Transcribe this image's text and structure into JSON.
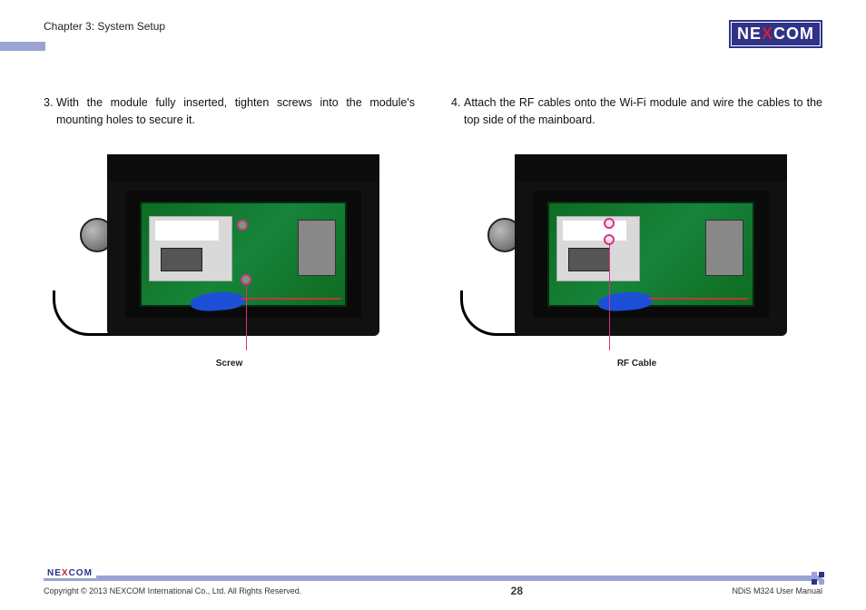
{
  "header": {
    "chapter": "Chapter 3: System Setup",
    "logo_pre": "NE",
    "logo_x": "X",
    "logo_post": "COM"
  },
  "steps": {
    "s3": {
      "num": "3.",
      "text": "With the module fully inserted, tighten screws into the module's mounting holes to secure it."
    },
    "s4": {
      "num": "4.",
      "text": "Attach the RF cables onto the Wi-Fi module and wire the cables to the top side of the mainboard."
    }
  },
  "callouts": {
    "left": "Screw",
    "right": "RF Cable"
  },
  "footer": {
    "logo_pre": "NE",
    "logo_x": "X",
    "logo_post": "COM",
    "copyright": "Copyright © 2013 NEXCOM International Co., Ltd. All Rights Reserved.",
    "page": "28",
    "doc": "NDiS M324 User Manual"
  }
}
